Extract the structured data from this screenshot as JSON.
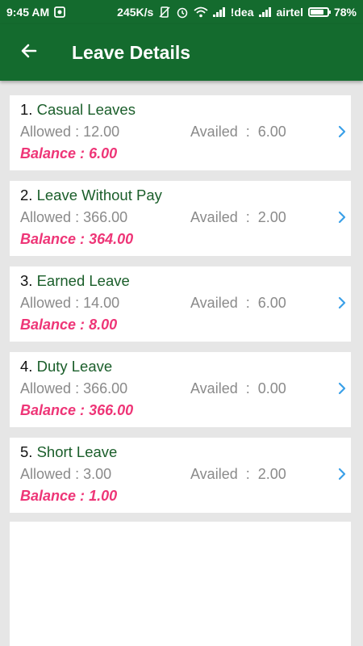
{
  "status_bar": {
    "time": "9:45 AM",
    "speed": "245K/s",
    "carrier1": "!dea",
    "carrier2": "airtel",
    "battery": "78%",
    "battery_level": 0.78
  },
  "header": {
    "title": "Leave Details",
    "color": "#146b2e"
  },
  "leaves": [
    {
      "index": "1.",
      "name": "Casual Leaves",
      "allowed_label": "Allowed",
      "allowed_sep": ":",
      "allowed_value": "12.00",
      "availed_label": "Availed",
      "availed_sep": ":",
      "availed_value": "6.00",
      "balance_label": "Balance :",
      "balance_value": "6.00"
    },
    {
      "index": "2.",
      "name": "Leave Without Pay",
      "allowed_label": "Allowed",
      "allowed_sep": ":",
      "allowed_value": "366.00",
      "availed_label": "Availed",
      "availed_sep": ":",
      "availed_value": "2.00",
      "balance_label": "Balance :",
      "balance_value": "364.00"
    },
    {
      "index": "3.",
      "name": "Earned Leave",
      "allowed_label": "Allowed",
      "allowed_sep": ":",
      "allowed_value": "14.00",
      "availed_label": "Availed",
      "availed_sep": ":",
      "availed_value": "6.00",
      "balance_label": "Balance :",
      "balance_value": "8.00"
    },
    {
      "index": "4.",
      "name": "Duty Leave",
      "allowed_label": "Allowed",
      "allowed_sep": ":",
      "allowed_value": "366.00",
      "availed_label": "Availed",
      "availed_sep": ":",
      "availed_value": "0.00",
      "balance_label": "Balance :",
      "balance_value": "366.00"
    },
    {
      "index": "5.",
      "name": "Short Leave",
      "allowed_label": "Allowed",
      "allowed_sep": ":",
      "allowed_value": "3.00",
      "availed_label": "Availed",
      "availed_sep": ":",
      "availed_value": "2.00",
      "balance_label": "Balance :",
      "balance_value": "1.00"
    }
  ],
  "colors": {
    "balance": "#ee3577",
    "leave_name": "#1a5e2a",
    "chevron": "#3aa0e8"
  },
  "icons": {
    "back": "arrow-left-icon",
    "row_action": "chevron-right-icon"
  }
}
